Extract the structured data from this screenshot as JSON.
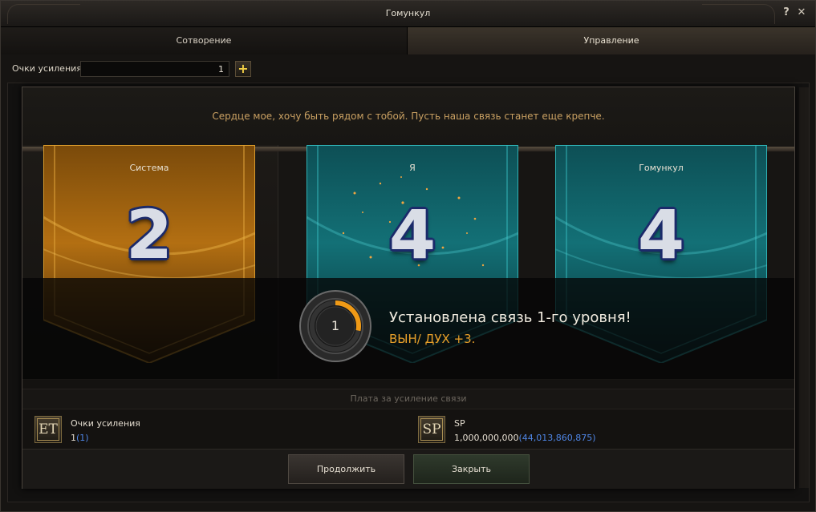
{
  "window": {
    "title": "Гомункул",
    "help_label": "?",
    "close_label": "✕"
  },
  "tabs": [
    {
      "label": "Сотворение",
      "active": false
    },
    {
      "label": "Управление",
      "active": true
    }
  ],
  "points": {
    "label": "Очки усиления",
    "value": "1",
    "plus_label": "+"
  },
  "dialog": {
    "message": "Сердце мое, хочу быть рядом с тобой. Пусть наша связь станет еще крепче.",
    "banners": [
      {
        "label": "Система",
        "value": "2",
        "color": "#c7841b"
      },
      {
        "label": "Я",
        "value": "4",
        "color": "#1e8a8f"
      },
      {
        "label": "Гомункул",
        "value": "4",
        "color": "#1e8a8f"
      }
    ],
    "notification": {
      "level": "1",
      "progress": 0.28,
      "title": "Установлена связь 1-го уровня!",
      "bonus": "ВЫН/ ДУХ +3."
    },
    "cost_header": "Плата за усиление связи",
    "costs": [
      {
        "icon_text": "ET",
        "icon": "enhance-points-icon",
        "name": "Очки усиления",
        "amount": "1",
        "have": "(1)"
      },
      {
        "icon_text": "SP",
        "icon": "sp-icon",
        "name": "SP",
        "amount": "1,000,000,000",
        "have": "(44,013,860,875)"
      }
    ],
    "buttons": {
      "continue": "Продолжить",
      "close": "Закрыть"
    }
  },
  "colors": {
    "accent_gold": "#e8a02a",
    "link_blue": "#4f86e6",
    "message": "#c9a062"
  }
}
